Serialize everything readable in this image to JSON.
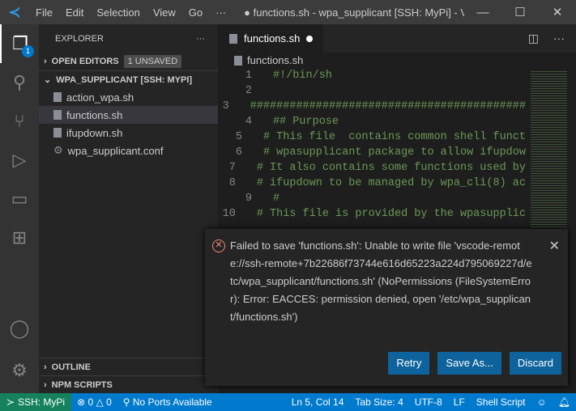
{
  "titlebar": {
    "menus": [
      "File",
      "Edit",
      "Selection",
      "View",
      "Go",
      "···"
    ],
    "window_title": "● functions.sh - wpa_supplicant [SSH: MyPi] - Visu..."
  },
  "activity": {
    "explorer_badge": "1"
  },
  "sidebar": {
    "title": "EXPLORER",
    "more": "···",
    "open_editors": "OPEN EDITORS",
    "unsaved": "1 UNSAVED",
    "folder": "WPA_SUPPLICANT [SSH: MYPI]",
    "files": [
      "action_wpa.sh",
      "functions.sh",
      "ifupdown.sh",
      "wpa_supplicant.conf"
    ],
    "outline": "OUTLINE",
    "npm": "NPM SCRIPTS"
  },
  "editor": {
    "tab": "functions.sh",
    "breadcrumb": "functions.sh",
    "lines": [
      {
        "n": "1",
        "t": "#!/bin/sh"
      },
      {
        "n": "2",
        "t": ""
      },
      {
        "n": "3",
        "t": "##########################################"
      },
      {
        "n": "4",
        "t": "## Purpose"
      },
      {
        "n": "5",
        "t": "# This file  contains common shell funct"
      },
      {
        "n": "6",
        "t": "# wpasupplicant package to allow ifupdow"
      },
      {
        "n": "7",
        "t": "# It also contains some functions used by"
      },
      {
        "n": "8",
        "t": "# ifupdown to be managed by wpa_cli(8) ac"
      },
      {
        "n": "9",
        "t": "#"
      },
      {
        "n": "10",
        "t": "# This file is provided by the wpasupplic"
      }
    ]
  },
  "notification": {
    "message": "Failed to save 'functions.sh': Unable to write file 'vscode-remote://ssh-remote+7b22686f73744e616d65223a224d795069227d/etc/wpa_supplicant/functions.sh' (NoPermissions (FileSystemError): Error: EACCES: permission denied, open '/etc/wpa_supplicant/functions.sh')",
    "buttons": [
      "Retry",
      "Save As...",
      "Discard"
    ]
  },
  "status": {
    "remote": "SSH: MyPi",
    "errors": "0",
    "warnings": "0",
    "ports": "No Ports Available",
    "position": "Ln 5, Col 14",
    "tab_size": "Tab Size: 4",
    "encoding": "UTF-8",
    "eol": "LF",
    "language": "Shell Script"
  }
}
